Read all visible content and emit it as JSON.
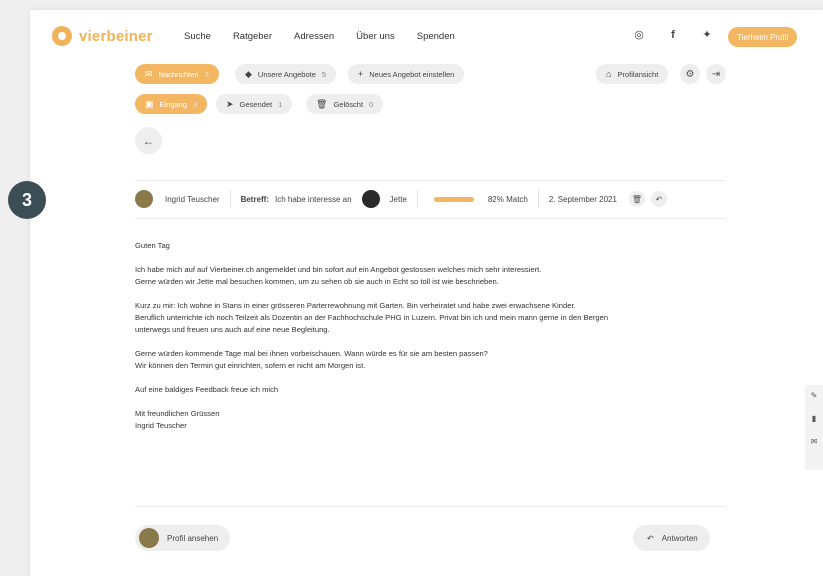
{
  "header": {
    "logo_text": "vierbeiner",
    "nav": [
      "Suche",
      "Ratgeber",
      "Adressen",
      "Über uns",
      "Spenden"
    ],
    "social_icons": [
      "instagram-icon",
      "facebook-icon",
      "twitter-icon"
    ],
    "profile_button": "Tierheim Profil"
  },
  "tabs_row1": {
    "messages": {
      "label": "Nachrichten",
      "count": "3"
    },
    "offers": {
      "label": "Unsere Angebote",
      "count": "5"
    },
    "new_offer": {
      "label": "Neues Angebot einstellen"
    },
    "profile_view": {
      "label": "Profilansicht"
    }
  },
  "tabs_row2": {
    "inbox": {
      "label": "Eingang",
      "count": "3"
    },
    "sent": {
      "label": "Gesendet",
      "count": "1"
    },
    "deleted": {
      "label": "Gelöscht",
      "count": "0"
    }
  },
  "step_badge": "3",
  "message": {
    "sender": "Ingrid Teuscher",
    "subject_label": "Betreff:",
    "subject": "Ich habe interesse an",
    "animal": "Jette",
    "match_percent": 82,
    "match_text": "82% Match",
    "date": "2. September 2021",
    "paragraphs": [
      [
        "Guten Tag"
      ],
      [
        "Ich habe mich auf auf Vierbeiner.ch angemeldet und bin sofort auf ein Angebot gestossen welches mich sehr interessiert.",
        "Gerne würden wir Jette mal besuchen kommen, um zu sehen ob sie auch in Echt so toll ist wie beschrieben."
      ],
      [
        "Kurz zu mir: Ich wohne in Stans in einer grösseren Parterrewohnung mit Garten. Bin verheiratet und habe zwei erwachsene Kinder.",
        "Beruflich unterrichte ich noch Teilzeit als Dozentin an der Fachhochschule PHG in Luzern. Privat bin ich und mein mann gerne in den Bergen",
        "unterwegs und freuen uns auch auf eine neue Begleitung."
      ],
      [
        "Gerne würden kommende Tage mal bei ihnen vorbeischauen. Wann würde es für sie am besten passen?",
        "Wir können den Termin gut einrichten, sofern er nicht am Morgen ist."
      ],
      [
        "Auf eine baldiges Feedback freue ich mich"
      ],
      [
        "Mit freundlichen Grüssen",
        "Ingrid Teuscher"
      ]
    ]
  },
  "footer": {
    "view_profile": "Profil ansehen",
    "reply": "Antworten"
  }
}
